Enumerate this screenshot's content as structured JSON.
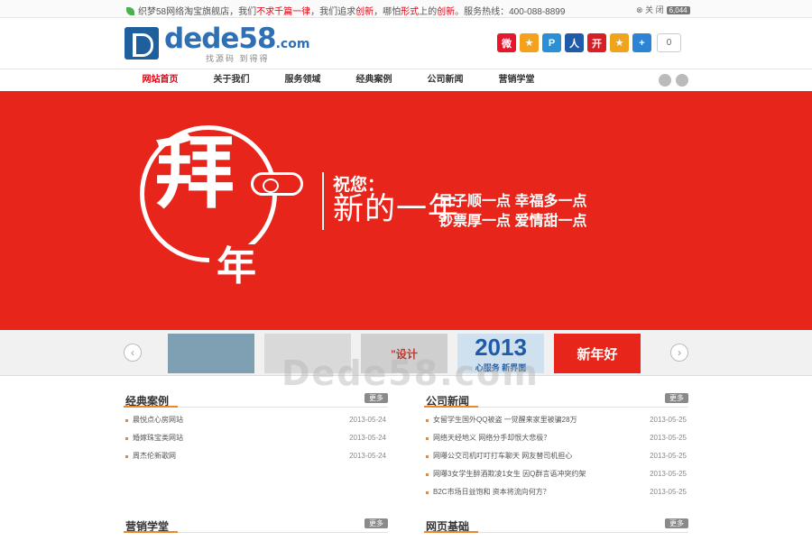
{
  "topbar": {
    "notice_prefix": "织梦58网络淘宝旗舰店，我们",
    "notice_hl1": "不求千篇一律",
    "notice_mid": "，我们追求",
    "notice_hl2": "创新",
    "notice_mid2": "，哪怕",
    "notice_hl3": "形式",
    "notice_mid3": "上的",
    "notice_hl4": "创新",
    "notice_suffix": "。服务热线：400-088-8899",
    "close_label": "关 闭",
    "close_count": "6,044"
  },
  "logo": {
    "word": "dede58",
    "suffix": ".com",
    "slogan": "找源码 到得得"
  },
  "share": {
    "icons": [
      {
        "name": "weibo-share-icon",
        "color": "#e6162d",
        "glyph": "微"
      },
      {
        "name": "qzone-share-icon",
        "color": "#f4a21b",
        "glyph": "★"
      },
      {
        "name": "tencent-weibo-share-icon",
        "color": "#2b8fd5",
        "glyph": "P"
      },
      {
        "name": "renren-share-icon",
        "color": "#1f5ba8",
        "glyph": "人"
      },
      {
        "name": "kaixin-share-icon",
        "color": "#d71f27",
        "glyph": "开"
      },
      {
        "name": "favorite-star-share-icon",
        "color": "#f0a41d",
        "glyph": "★"
      },
      {
        "name": "more-share-icon",
        "color": "#2e84d4",
        "glyph": "+"
      }
    ],
    "count": "0"
  },
  "nav": {
    "items": [
      "网站首页",
      "关于我们",
      "服务领域",
      "经典案例",
      "公司新闻",
      "营销学堂"
    ],
    "active_index": 0
  },
  "banner": {
    "big_char": "拜",
    "nian_char": "年",
    "wish": "祝您：",
    "new_year": "新的一年",
    "line1": "日子顺一点  幸福多一点",
    "line2": "钞票厚一点  爱情甜一点"
  },
  "thumbs": [
    {
      "caption": "",
      "bg": "#7f9fb3"
    },
    {
      "caption": "",
      "bg": "#d9d9d9"
    },
    {
      "caption": "\"设计",
      "bg": "#cfcfcf"
    },
    {
      "caption": "",
      "bg": "#9fb2c3"
    },
    {
      "caption": "2013",
      "sub": "心服务 新界面",
      "bg": "#cfe1ef"
    },
    {
      "caption": "新年好",
      "bg": "#e8251b"
    }
  ],
  "watermark": "Dede58.com",
  "cases": {
    "title": "经典案例",
    "more": "更多",
    "items": [
      {
        "text": "晨悦点心房网站",
        "date": "2013-05-24"
      },
      {
        "text": "婚嫁珠宝类网站",
        "date": "2013-05-24"
      },
      {
        "text": "周杰伦新歌网",
        "date": "2013-05-24"
      }
    ]
  },
  "news": {
    "title": "公司新闻",
    "more": "更多",
    "items": [
      {
        "text": "女留学生国外QQ被盗 一觉醒来家里被骗28万",
        "date": "2013-05-25"
      },
      {
        "text": "网络天经地义 网络分手却恨大悲极？",
        "date": "2013-05-25"
      },
      {
        "text": "网曝公交司机叮叮打车聊天 网友替司机担心",
        "date": "2013-05-25"
      },
      {
        "text": "网曝3女学生醉酒欺凌1女生 因Q群言语冲突约架",
        "date": "2013-05-25"
      },
      {
        "text": "B2C市场日益饱和 资本将流向何方？",
        "date": "2013-05-25"
      }
    ]
  },
  "marketing": {
    "title": "营销学堂",
    "more": "更多"
  },
  "webbase": {
    "title": "网页基础",
    "more": "更多"
  }
}
